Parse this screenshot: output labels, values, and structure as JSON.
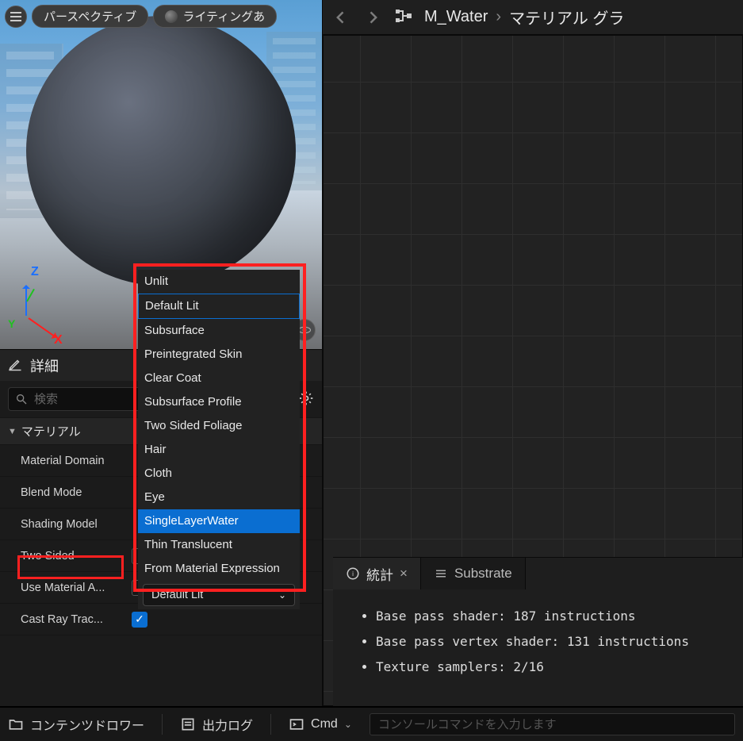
{
  "viewport": {
    "perspective_label": "パースペクティブ",
    "lighting_label": "ライティングあ",
    "axis_labels": {
      "x": "X",
      "y": "Y",
      "z": "Z"
    }
  },
  "details": {
    "panel_title": "詳細",
    "search_placeholder": "検索",
    "section_label": "マテリアル",
    "rows": {
      "material_domain": "Material Domain",
      "blend_mode": "Blend Mode",
      "shading_model": "Shading Model",
      "two_sided": "Two Sided",
      "use_material": "Use Material A...",
      "cast_ray": "Cast Ray Trac..."
    }
  },
  "shading_model_dropdown": {
    "options": [
      "Unlit",
      "Default Lit",
      "Subsurface",
      "Preintegrated Skin",
      "Clear Coat",
      "Subsurface Profile",
      "Two Sided Foliage",
      "Hair",
      "Cloth",
      "Eye",
      "SingleLayerWater",
      "Thin Translucent",
      "From Material Expression"
    ],
    "selected": "Default Lit",
    "highlighted": "SingleLayerWater",
    "boxed": "Default Lit"
  },
  "graph": {
    "breadcrumb_item": "M_Water",
    "breadcrumb_tail": "マテリアル グラ"
  },
  "stats": {
    "tab_stats": "統計",
    "tab_substrate": "Substrate",
    "lines": [
      "Base pass shader: 187 instructions",
      "Base pass vertex shader: 131 instructions",
      "Texture samplers: 2/16"
    ]
  },
  "bottom_bar": {
    "content_drawer": "コンテンツドロワー",
    "output_log": "出力ログ",
    "cmd_label": "Cmd",
    "cmd_placeholder": "コンソールコマンドを入力します"
  }
}
